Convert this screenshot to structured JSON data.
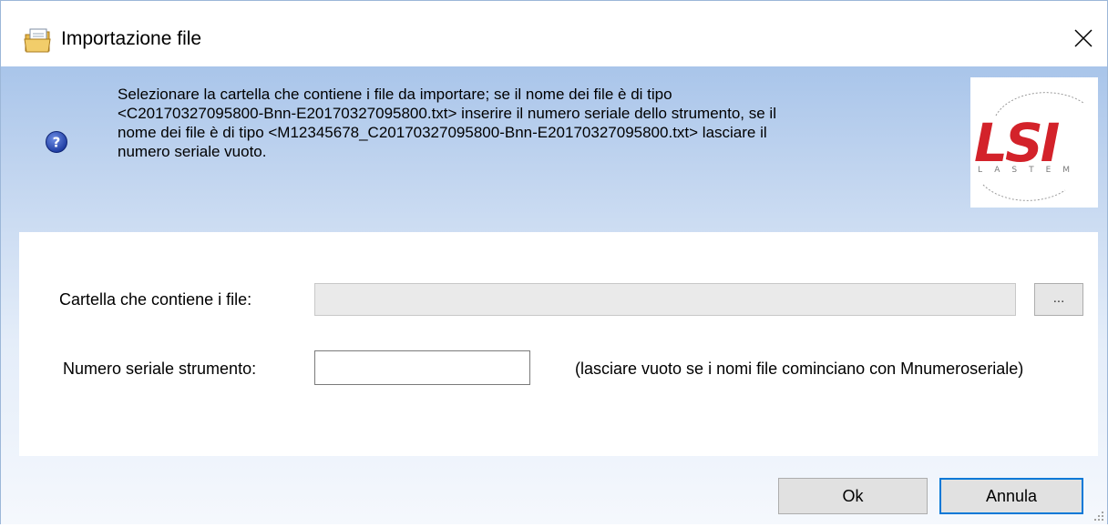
{
  "window": {
    "title": "Importazione file",
    "title_icon": "folder-document-icon",
    "close_icon": "close-icon"
  },
  "header": {
    "help_icon": "question-icon",
    "instructions": [
      "Selezionare la cartella che contiene i file da importare; se il nome dei file è di tipo",
      "<C20170327095800-Bnn-E20170327095800.txt> inserire il numero seriale dello strumento, se il",
      "nome dei file è di tipo <M12345678_C20170327095800-Bnn-E20170327095800.txt> lasciare il",
      "numero seriale vuoto."
    ],
    "logo": {
      "brand": "LSI",
      "subtitle": "LASTEM",
      "brand_color": "#d3222a",
      "accent_color": "#7a7a7a"
    }
  },
  "form": {
    "folder_label": "Cartella che contiene i file:",
    "folder_value": "",
    "browse_label": "...",
    "serial_label": "Numero seriale strumento:",
    "serial_value": "",
    "serial_hint": "(lasciare vuoto se i nomi file cominciano con Mnumeroseriale)"
  },
  "buttons": {
    "ok_label": "Ok",
    "cancel_label": "Annula"
  },
  "colors": {
    "header_gradient_top": "#a9c5ea",
    "focus_border": "#0078d7",
    "help_icon": "#2a4fb8"
  }
}
